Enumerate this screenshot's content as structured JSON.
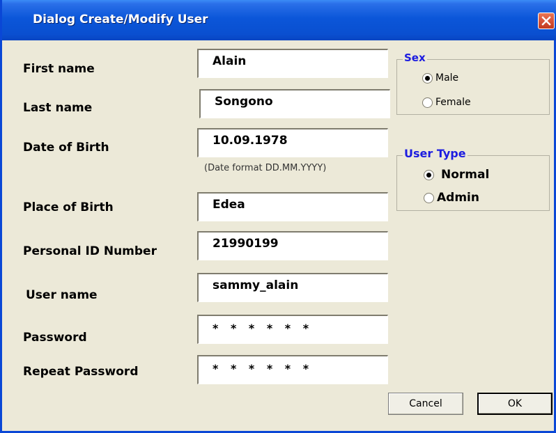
{
  "window": {
    "title": "Dialog Create/Modify User",
    "close_icon": "close-icon",
    "colors": {
      "titlebar": "#0A56D9",
      "background": "#ECE9D8",
      "close_button": "#D6533A",
      "legend_text": "#1C1CE0"
    }
  },
  "form": {
    "first_name": {
      "label": "First name",
      "value": "Alain"
    },
    "last_name": {
      "label": "Last name",
      "value": "Songono"
    },
    "date_of_birth": {
      "label": "Date of Birth",
      "value": "10.09.1978",
      "hint": "(Date format  DD.MM.YYYY)"
    },
    "place_of_birth": {
      "label": "Place of Birth",
      "value": "Edea"
    },
    "personal_id": {
      "label": "Personal ID Number",
      "value": "21990199"
    },
    "user_name": {
      "label": "User name",
      "value": "sammy_alain"
    },
    "password": {
      "label": "Password",
      "value": "* * * * * *"
    },
    "repeat_password": {
      "label": "Repeat Password",
      "value": "* * * * * *"
    }
  },
  "sex": {
    "legend": "Sex",
    "options": [
      {
        "label": "Male",
        "selected": true
      },
      {
        "label": "Female",
        "selected": false
      }
    ]
  },
  "user_type": {
    "legend": "User Type",
    "options": [
      {
        "label": "Normal",
        "selected": true
      },
      {
        "label": "Admin",
        "selected": false
      }
    ]
  },
  "buttons": {
    "cancel": "Cancel",
    "ok": "OK"
  }
}
